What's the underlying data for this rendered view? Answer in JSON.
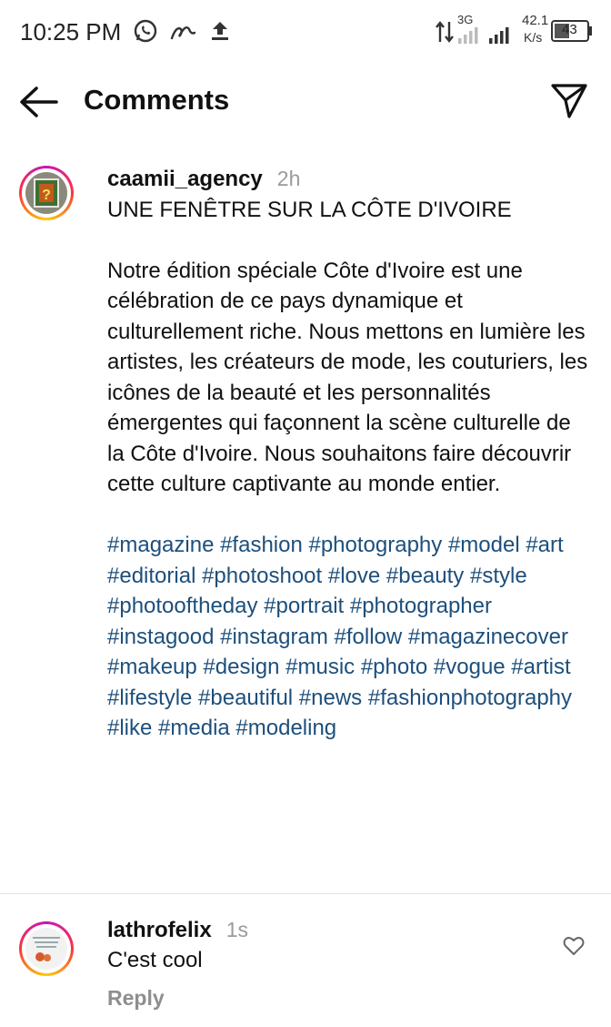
{
  "status_bar": {
    "time": "10:25 PM",
    "network_type": "3G",
    "speed_value": "42.1",
    "speed_unit": "K/s",
    "battery": "43",
    "icons": [
      "whatsapp-icon",
      "notification-icon",
      "upload-icon",
      "data-transfer-icon",
      "signal-icon",
      "battery-icon"
    ]
  },
  "header": {
    "title": "Comments",
    "icons": [
      "back-arrow-icon",
      "send-icon"
    ]
  },
  "caption": {
    "username": "caamii_agency",
    "time": "2h",
    "text": "UNE FENÊTRE SUR LA CÔTE D'IVOIRE\n\nNotre édition spéciale Côte d'Ivoire est une célébration de ce pays dynamique et culturellement riche. Nous mettons en lumière les artistes, les créateurs de mode, les couturiers, les icônes de la beauté et les personnalités émergentes qui façonnent la scène culturelle de la Côte d'Ivoire. Nous souhaitons faire découvrir cette culture captivante au monde entier.",
    "hashtags": "#magazine #fashion #photography #model #art #editorial #photoshoot #love #beauty #style #photooftheday #portrait #photographer #instagood #instagram #follow #magazinecover #makeup #design #music #photo #vogue #artist #lifestyle #beautiful #news #fashionphotography #like #media #modeling"
  },
  "comments": [
    {
      "username": "lathrofelix",
      "time": "1s",
      "text": "C'est cool",
      "reply_label": "Reply"
    }
  ],
  "colors": {
    "hashtag": "#1d4f7c",
    "muted": "#8e8e8e",
    "ring_gradient": [
      "#c913b9",
      "#f9373f",
      "#fecd00"
    ]
  }
}
